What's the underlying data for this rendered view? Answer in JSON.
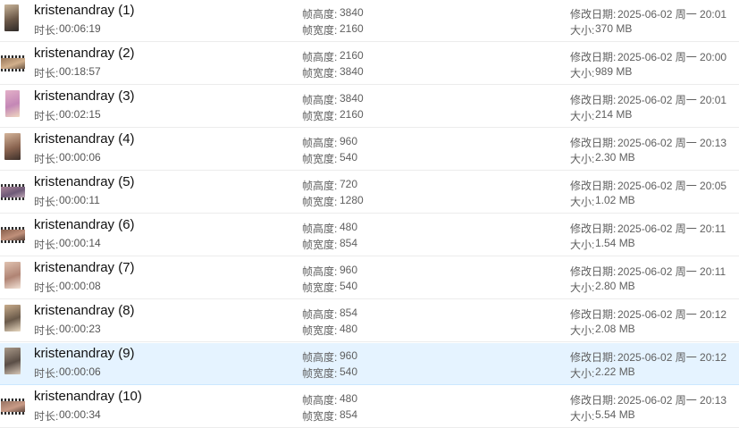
{
  "labels": {
    "duration": "时长:",
    "frame_height": "帧高度:",
    "frame_width": "帧宽度:",
    "modified": "修改日期:",
    "size": "大小:"
  },
  "files": [
    {
      "name": "kristenandray (1)",
      "duration": "00:06:19",
      "height": "3840",
      "width": "2160",
      "modified": "2025-06-02 周一 20:01",
      "size": "370 MB",
      "selected": false
    },
    {
      "name": "kristenandray (2)",
      "duration": "00:18:57",
      "height": "2160",
      "width": "3840",
      "modified": "2025-06-02 周一 20:00",
      "size": "989 MB",
      "selected": false
    },
    {
      "name": "kristenandray (3)",
      "duration": "00:02:15",
      "height": "3840",
      "width": "2160",
      "modified": "2025-06-02 周一 20:01",
      "size": "214 MB",
      "selected": false
    },
    {
      "name": "kristenandray (4)",
      "duration": "00:00:06",
      "height": "960",
      "width": "540",
      "modified": "2025-06-02 周一 20:13",
      "size": "2.30 MB",
      "selected": false
    },
    {
      "name": "kristenandray (5)",
      "duration": "00:00:11",
      "height": "720",
      "width": "1280",
      "modified": "2025-06-02 周一 20:05",
      "size": "1.02 MB",
      "selected": false
    },
    {
      "name": "kristenandray (6)",
      "duration": "00:00:14",
      "height": "480",
      "width": "854",
      "modified": "2025-06-02 周一 20:11",
      "size": "1.54 MB",
      "selected": false
    },
    {
      "name": "kristenandray (7)",
      "duration": "00:00:08",
      "height": "960",
      "width": "540",
      "modified": "2025-06-02 周一 20:11",
      "size": "2.80 MB",
      "selected": false
    },
    {
      "name": "kristenandray (8)",
      "duration": "00:00:23",
      "height": "854",
      "width": "480",
      "modified": "2025-06-02 周一 20:12",
      "size": "2.08 MB",
      "selected": false
    },
    {
      "name": "kristenandray (9)",
      "duration": "00:00:06",
      "height": "960",
      "width": "540",
      "modified": "2025-06-02 周一 20:12",
      "size": "2.22 MB",
      "selected": true
    },
    {
      "name": "kristenandray (10)",
      "duration": "00:00:34",
      "height": "480",
      "width": "854",
      "modified": "2025-06-02 周一 20:13",
      "size": "5.54 MB",
      "selected": false
    }
  ],
  "thumbnails": [
    {
      "colors": [
        "#c9b59a",
        "#6b5848",
        "#2e2a28"
      ]
    },
    {
      "colors": [
        "#8c6a4e",
        "#d2b08c",
        "#4a3a30"
      ]
    },
    {
      "colors": [
        "#e3b0c8",
        "#c487b6",
        "#f0d8c0"
      ]
    },
    {
      "colors": [
        "#d4b49a",
        "#8a6450",
        "#3c302a"
      ]
    },
    {
      "colors": [
        "#b88ea0",
        "#6e5a78",
        "#d8c0c8"
      ]
    },
    {
      "colors": [
        "#7a5442",
        "#c0907a",
        "#3a2a24"
      ]
    },
    {
      "colors": [
        "#e0c2b0",
        "#b08474",
        "#f2e2d6"
      ]
    },
    {
      "colors": [
        "#c8ac8c",
        "#6a5a4a",
        "#e8d8c0"
      ]
    },
    {
      "colors": [
        "#a89888",
        "#5a4e46",
        "#d8c8b8"
      ]
    },
    {
      "colors": [
        "#8c6a5a",
        "#c89a86",
        "#40302a"
      ]
    }
  ]
}
